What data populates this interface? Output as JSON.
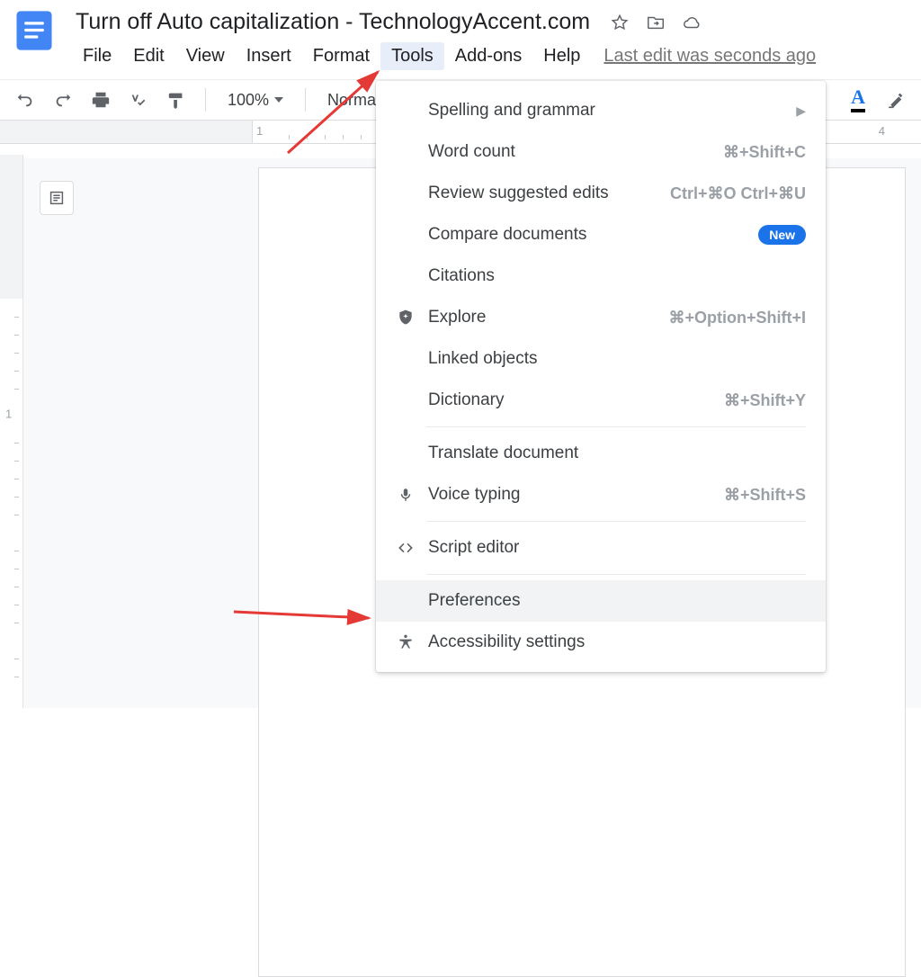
{
  "header": {
    "doc_title": "Turn off Auto capitalization - TechnologyAccent.com"
  },
  "menubar": {
    "items": [
      "File",
      "Edit",
      "View",
      "Insert",
      "Format",
      "Tools",
      "Add-ons",
      "Help"
    ],
    "active_index": 5,
    "last_edit": "Last edit was seconds ago"
  },
  "toolbar": {
    "zoom": "100%",
    "style_name": "Normal",
    "text_color_glyph": "A"
  },
  "ruler": {
    "h_numbers": [
      "1",
      "4"
    ],
    "v_numbers": [
      "1"
    ]
  },
  "dropdown": {
    "items": [
      {
        "label": "Spelling and grammar",
        "right": "",
        "arrow": true,
        "icon": ""
      },
      {
        "label": "Word count",
        "right": "⌘+Shift+C",
        "icon": ""
      },
      {
        "label": "Review suggested edits",
        "right": "Ctrl+⌘O Ctrl+⌘U",
        "icon": ""
      },
      {
        "label": "Compare documents",
        "badge_new": "New",
        "icon": ""
      },
      {
        "label": "Citations",
        "icon": ""
      },
      {
        "label": "Explore",
        "right": "⌘+Option+Shift+I",
        "icon": "explore"
      },
      {
        "label": "Linked objects",
        "icon": ""
      },
      {
        "label": "Dictionary",
        "right": "⌘+Shift+Y",
        "icon": ""
      },
      {
        "sep": true
      },
      {
        "label": "Translate document",
        "icon": ""
      },
      {
        "label": "Voice typing",
        "right": "⌘+Shift+S",
        "icon": "mic"
      },
      {
        "sep": true
      },
      {
        "label": "Script editor",
        "icon": "code"
      },
      {
        "sep": true
      },
      {
        "label": "Preferences",
        "icon": "",
        "hover": true
      },
      {
        "label": "Accessibility settings",
        "icon": "accessibility"
      }
    ]
  }
}
